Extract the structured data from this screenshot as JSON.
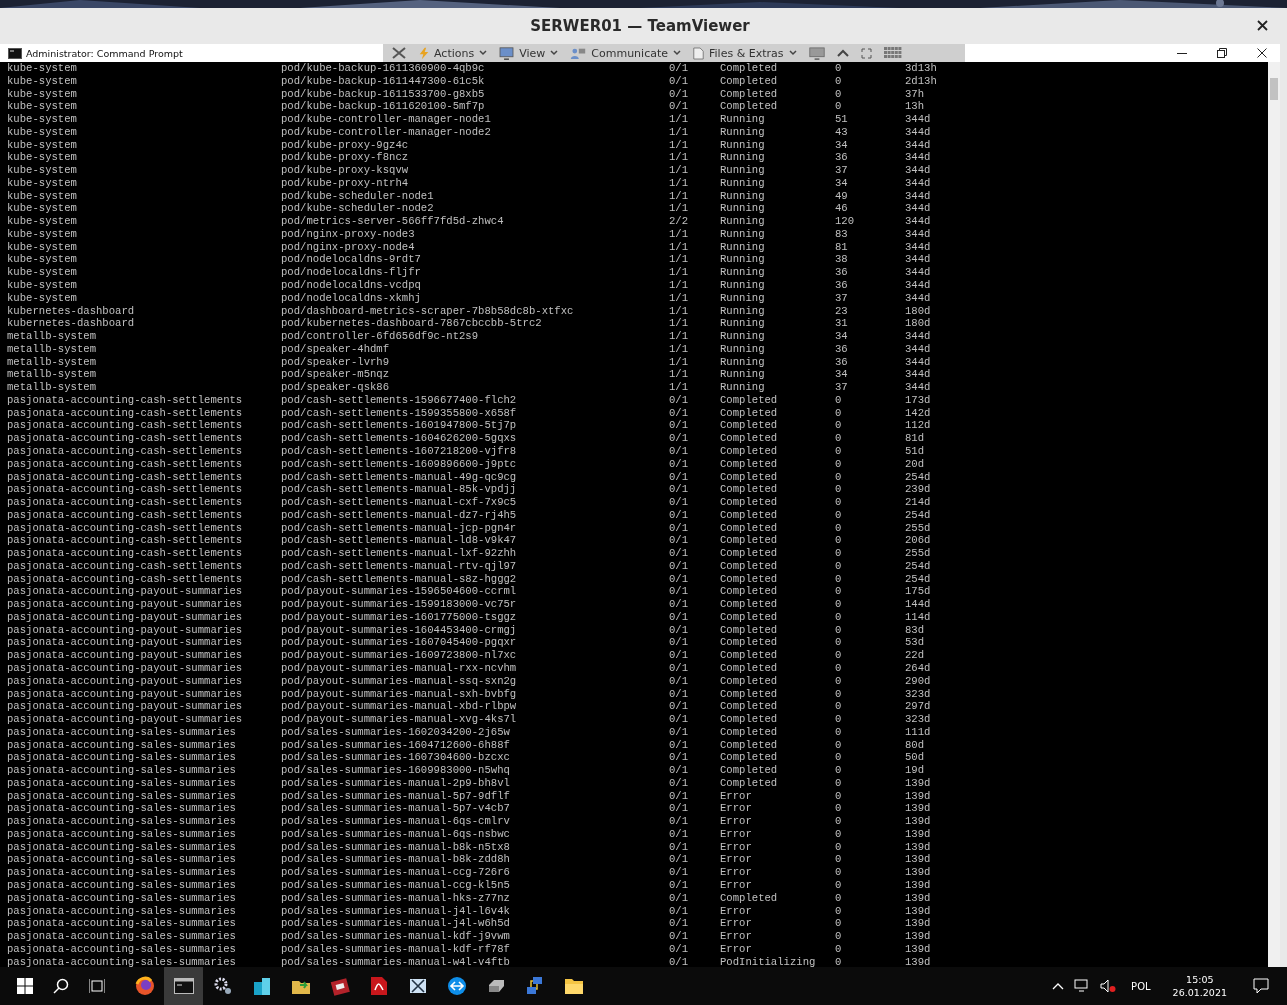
{
  "window": {
    "title": "SERWER01 — TeamViewer"
  },
  "remote_toolbar": {
    "menus": [
      "Actions",
      "View",
      "Communicate",
      "Files & Extras"
    ]
  },
  "console": {
    "title": "Administrator: Command Prompt",
    "rows": [
      [
        "kube-system",
        "pod/kube-backup-1611360900-4qb9c",
        "0/1",
        "Completed",
        "0",
        "3d13h"
      ],
      [
        "kube-system",
        "pod/kube-backup-1611447300-61c5k",
        "0/1",
        "Completed",
        "0",
        "2d13h"
      ],
      [
        "kube-system",
        "pod/kube-backup-1611533700-g8xb5",
        "0/1",
        "Completed",
        "0",
        "37h"
      ],
      [
        "kube-system",
        "pod/kube-backup-1611620100-5mf7p",
        "0/1",
        "Completed",
        "0",
        "13h"
      ],
      [
        "kube-system",
        "pod/kube-controller-manager-node1",
        "1/1",
        "Running",
        "51",
        "344d"
      ],
      [
        "kube-system",
        "pod/kube-controller-manager-node2",
        "1/1",
        "Running",
        "43",
        "344d"
      ],
      [
        "kube-system",
        "pod/kube-proxy-9gz4c",
        "1/1",
        "Running",
        "34",
        "344d"
      ],
      [
        "kube-system",
        "pod/kube-proxy-f8ncz",
        "1/1",
        "Running",
        "36",
        "344d"
      ],
      [
        "kube-system",
        "pod/kube-proxy-ksqvw",
        "1/1",
        "Running",
        "37",
        "344d"
      ],
      [
        "kube-system",
        "pod/kube-proxy-ntrh4",
        "1/1",
        "Running",
        "34",
        "344d"
      ],
      [
        "kube-system",
        "pod/kube-scheduler-node1",
        "1/1",
        "Running",
        "49",
        "344d"
      ],
      [
        "kube-system",
        "pod/kube-scheduler-node2",
        "1/1",
        "Running",
        "46",
        "344d"
      ],
      [
        "kube-system",
        "pod/metrics-server-566ff7fd5d-zhwc4",
        "2/2",
        "Running",
        "120",
        "344d"
      ],
      [
        "kube-system",
        "pod/nginx-proxy-node3",
        "1/1",
        "Running",
        "83",
        "344d"
      ],
      [
        "kube-system",
        "pod/nginx-proxy-node4",
        "1/1",
        "Running",
        "81",
        "344d"
      ],
      [
        "kube-system",
        "pod/nodelocaldns-9rdt7",
        "1/1",
        "Running",
        "38",
        "344d"
      ],
      [
        "kube-system",
        "pod/nodelocaldns-fljfr",
        "1/1",
        "Running",
        "36",
        "344d"
      ],
      [
        "kube-system",
        "pod/nodelocaldns-vcdpq",
        "1/1",
        "Running",
        "36",
        "344d"
      ],
      [
        "kube-system",
        "pod/nodelocaldns-xkmhj",
        "1/1",
        "Running",
        "37",
        "344d"
      ],
      [
        "kubernetes-dashboard",
        "pod/dashboard-metrics-scraper-7b8b58dc8b-xtfxc",
        "1/1",
        "Running",
        "23",
        "180d"
      ],
      [
        "kubernetes-dashboard",
        "pod/kubernetes-dashboard-7867cbccbb-5trc2",
        "1/1",
        "Running",
        "31",
        "180d"
      ],
      [
        "metallb-system",
        "pod/controller-6fd656df9c-nt2s9",
        "1/1",
        "Running",
        "34",
        "344d"
      ],
      [
        "metallb-system",
        "pod/speaker-4hdmf",
        "1/1",
        "Running",
        "36",
        "344d"
      ],
      [
        "metallb-system",
        "pod/speaker-lvrh9",
        "1/1",
        "Running",
        "36",
        "344d"
      ],
      [
        "metallb-system",
        "pod/speaker-m5nqz",
        "1/1",
        "Running",
        "34",
        "344d"
      ],
      [
        "metallb-system",
        "pod/speaker-qsk86",
        "1/1",
        "Running",
        "37",
        "344d"
      ],
      [
        "pasjonata-accounting-cash-settlements",
        "pod/cash-settlements-1596677400-flch2",
        "0/1",
        "Completed",
        "0",
        "173d"
      ],
      [
        "pasjonata-accounting-cash-settlements",
        "pod/cash-settlements-1599355800-x658f",
        "0/1",
        "Completed",
        "0",
        "142d"
      ],
      [
        "pasjonata-accounting-cash-settlements",
        "pod/cash-settlements-1601947800-5tj7p",
        "0/1",
        "Completed",
        "0",
        "112d"
      ],
      [
        "pasjonata-accounting-cash-settlements",
        "pod/cash-settlements-1604626200-5gqxs",
        "0/1",
        "Completed",
        "0",
        "81d"
      ],
      [
        "pasjonata-accounting-cash-settlements",
        "pod/cash-settlements-1607218200-vjfr8",
        "0/1",
        "Completed",
        "0",
        "51d"
      ],
      [
        "pasjonata-accounting-cash-settlements",
        "pod/cash-settlements-1609896600-j9ptc",
        "0/1",
        "Completed",
        "0",
        "20d"
      ],
      [
        "pasjonata-accounting-cash-settlements",
        "pod/cash-settlements-manual-49g-qc9cg",
        "0/1",
        "Completed",
        "0",
        "254d"
      ],
      [
        "pasjonata-accounting-cash-settlements",
        "pod/cash-settlements-manual-85k-vpdjj",
        "0/1",
        "Completed",
        "0",
        "239d"
      ],
      [
        "pasjonata-accounting-cash-settlements",
        "pod/cash-settlements-manual-cxf-7x9c5",
        "0/1",
        "Completed",
        "0",
        "214d"
      ],
      [
        "pasjonata-accounting-cash-settlements",
        "pod/cash-settlements-manual-dz7-rj4h5",
        "0/1",
        "Completed",
        "0",
        "254d"
      ],
      [
        "pasjonata-accounting-cash-settlements",
        "pod/cash-settlements-manual-jcp-pgn4r",
        "0/1",
        "Completed",
        "0",
        "255d"
      ],
      [
        "pasjonata-accounting-cash-settlements",
        "pod/cash-settlements-manual-ld8-v9k47",
        "0/1",
        "Completed",
        "0",
        "206d"
      ],
      [
        "pasjonata-accounting-cash-settlements",
        "pod/cash-settlements-manual-lxf-92zhh",
        "0/1",
        "Completed",
        "0",
        "255d"
      ],
      [
        "pasjonata-accounting-cash-settlements",
        "pod/cash-settlements-manual-rtv-qjl97",
        "0/1",
        "Completed",
        "0",
        "254d"
      ],
      [
        "pasjonata-accounting-cash-settlements",
        "pod/cash-settlements-manual-s8z-hggg2",
        "0/1",
        "Completed",
        "0",
        "254d"
      ],
      [
        "pasjonata-accounting-payout-summaries",
        "pod/payout-summaries-1596504600-ccrml",
        "0/1",
        "Completed",
        "0",
        "175d"
      ],
      [
        "pasjonata-accounting-payout-summaries",
        "pod/payout-summaries-1599183000-vc75r",
        "0/1",
        "Completed",
        "0",
        "144d"
      ],
      [
        "pasjonata-accounting-payout-summaries",
        "pod/payout-summaries-1601775000-tsggz",
        "0/1",
        "Completed",
        "0",
        "114d"
      ],
      [
        "pasjonata-accounting-payout-summaries",
        "pod/payout-summaries-1604453400-crmgj",
        "0/1",
        "Completed",
        "0",
        "83d"
      ],
      [
        "pasjonata-accounting-payout-summaries",
        "pod/payout-summaries-1607045400-pgqxr",
        "0/1",
        "Completed",
        "0",
        "53d"
      ],
      [
        "pasjonata-accounting-payout-summaries",
        "pod/payout-summaries-1609723800-nl7xc",
        "0/1",
        "Completed",
        "0",
        "22d"
      ],
      [
        "pasjonata-accounting-payout-summaries",
        "pod/payout-summaries-manual-rxx-ncvhm",
        "0/1",
        "Completed",
        "0",
        "264d"
      ],
      [
        "pasjonata-accounting-payout-summaries",
        "pod/payout-summaries-manual-ssq-sxn2g",
        "0/1",
        "Completed",
        "0",
        "290d"
      ],
      [
        "pasjonata-accounting-payout-summaries",
        "pod/payout-summaries-manual-sxh-bvbfg",
        "0/1",
        "Completed",
        "0",
        "323d"
      ],
      [
        "pasjonata-accounting-payout-summaries",
        "pod/payout-summaries-manual-xbd-rlbpw",
        "0/1",
        "Completed",
        "0",
        "297d"
      ],
      [
        "pasjonata-accounting-payout-summaries",
        "pod/payout-summaries-manual-xvg-4ks7l",
        "0/1",
        "Completed",
        "0",
        "323d"
      ],
      [
        "pasjonata-accounting-sales-summaries",
        "pod/sales-summaries-1602034200-2j65w",
        "0/1",
        "Completed",
        "0",
        "111d"
      ],
      [
        "pasjonata-accounting-sales-summaries",
        "pod/sales-summaries-1604712600-6h88f",
        "0/1",
        "Completed",
        "0",
        "80d"
      ],
      [
        "pasjonata-accounting-sales-summaries",
        "pod/sales-summaries-1607304600-bzcxc",
        "0/1",
        "Completed",
        "0",
        "50d"
      ],
      [
        "pasjonata-accounting-sales-summaries",
        "pod/sales-summaries-1609983000-n5whq",
        "0/1",
        "Completed",
        "0",
        "19d"
      ],
      [
        "pasjonata-accounting-sales-summaries",
        "pod/sales-summaries-manual-2p9-bh8vl",
        "0/1",
        "Completed",
        "0",
        "139d"
      ],
      [
        "pasjonata-accounting-sales-summaries",
        "pod/sales-summaries-manual-5p7-9dflf",
        "0/1",
        "Error",
        "0",
        "139d"
      ],
      [
        "pasjonata-accounting-sales-summaries",
        "pod/sales-summaries-manual-5p7-v4cb7",
        "0/1",
        "Error",
        "0",
        "139d"
      ],
      [
        "pasjonata-accounting-sales-summaries",
        "pod/sales-summaries-manual-6qs-cmlrv",
        "0/1",
        "Error",
        "0",
        "139d"
      ],
      [
        "pasjonata-accounting-sales-summaries",
        "pod/sales-summaries-manual-6qs-nsbwc",
        "0/1",
        "Error",
        "0",
        "139d"
      ],
      [
        "pasjonata-accounting-sales-summaries",
        "pod/sales-summaries-manual-b8k-n5tx8",
        "0/1",
        "Error",
        "0",
        "139d"
      ],
      [
        "pasjonata-accounting-sales-summaries",
        "pod/sales-summaries-manual-b8k-zdd8h",
        "0/1",
        "Error",
        "0",
        "139d"
      ],
      [
        "pasjonata-accounting-sales-summaries",
        "pod/sales-summaries-manual-ccg-726r6",
        "0/1",
        "Error",
        "0",
        "139d"
      ],
      [
        "pasjonata-accounting-sales-summaries",
        "pod/sales-summaries-manual-ccg-kl5n5",
        "0/1",
        "Error",
        "0",
        "139d"
      ],
      [
        "pasjonata-accounting-sales-summaries",
        "pod/sales-summaries-manual-hks-z77nz",
        "0/1",
        "Completed",
        "0",
        "139d"
      ],
      [
        "pasjonata-accounting-sales-summaries",
        "pod/sales-summaries-manual-j4l-l6v4k",
        "0/1",
        "Error",
        "0",
        "139d"
      ],
      [
        "pasjonata-accounting-sales-summaries",
        "pod/sales-summaries-manual-j4l-w6h5d",
        "0/1",
        "Error",
        "0",
        "139d"
      ],
      [
        "pasjonata-accounting-sales-summaries",
        "pod/sales-summaries-manual-kdf-j9vwm",
        "0/1",
        "Error",
        "0",
        "139d"
      ],
      [
        "pasjonata-accounting-sales-summaries",
        "pod/sales-summaries-manual-kdf-rf78f",
        "0/1",
        "Error",
        "0",
        "139d"
      ],
      [
        "pasjonata-accounting-sales-summaries",
        "pod/sales-summaries-manual-w4l-v4ftb",
        "0/1",
        "PodInitializing",
        "0",
        "139d"
      ]
    ]
  },
  "taskbar": {
    "language": "POL",
    "time": "15:05",
    "date": "26.01.2021"
  }
}
